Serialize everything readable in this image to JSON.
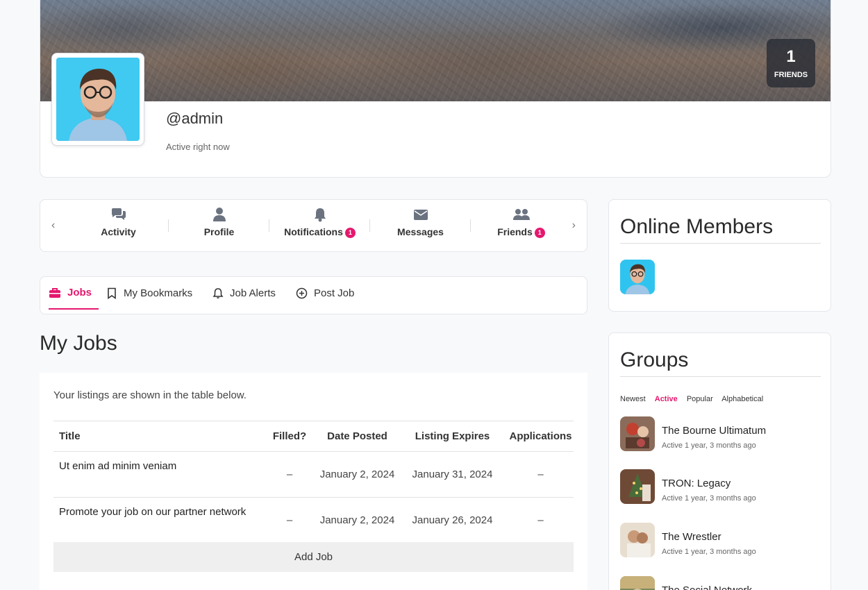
{
  "profile": {
    "username": "@admin",
    "status": "Active right now",
    "friends_count": "1",
    "friends_label": "FRIENDS"
  },
  "nav": {
    "items": [
      {
        "label": "Activity",
        "icon": "comments-icon"
      },
      {
        "label": "Profile",
        "icon": "user-icon"
      },
      {
        "label": "Notifications",
        "icon": "bell-icon",
        "badge": "1"
      },
      {
        "label": "Messages",
        "icon": "envelope-icon"
      },
      {
        "label": "Friends",
        "icon": "users-icon",
        "badge": "1"
      }
    ]
  },
  "job_tabs": [
    {
      "label": "Jobs",
      "icon": "briefcase-icon",
      "active": true
    },
    {
      "label": "My Bookmarks",
      "icon": "bookmark-icon"
    },
    {
      "label": "Job Alerts",
      "icon": "bell-icon"
    },
    {
      "label": "Post Job",
      "icon": "plus-circle-icon"
    }
  ],
  "jobs": {
    "title": "My Jobs",
    "intro": "Your listings are shown in the table below.",
    "columns": [
      "Title",
      "Filled?",
      "Date Posted",
      "Listing Expires",
      "Applications"
    ],
    "rows": [
      {
        "title": "Ut enim ad minim veniam",
        "filled": "–",
        "posted": "January 2, 2024",
        "expires": "January 31, 2024",
        "applications": "–"
      },
      {
        "title": "Promote your job on our partner network",
        "filled": "–",
        "posted": "January 2, 2024",
        "expires": "January 26, 2024",
        "applications": "–"
      }
    ],
    "add_label": "Add Job"
  },
  "sidebar": {
    "online_title": "Online Members",
    "groups_title": "Groups",
    "group_filters": [
      "Newest",
      "Active",
      "Popular",
      "Alphabetical"
    ],
    "active_filter": "Active",
    "groups": [
      {
        "name": "The Bourne Ultimatum",
        "meta": "Active 1 year, 3 months ago"
      },
      {
        "name": "TRON: Legacy",
        "meta": "Active 1 year, 3 months ago"
      },
      {
        "name": "The Wrestler",
        "meta": "Active 1 year, 3 months ago"
      },
      {
        "name": "The Social Network",
        "meta": ""
      }
    ]
  },
  "colors": {
    "accent": "#e5186e",
    "icon_gray": "#6b7280"
  }
}
